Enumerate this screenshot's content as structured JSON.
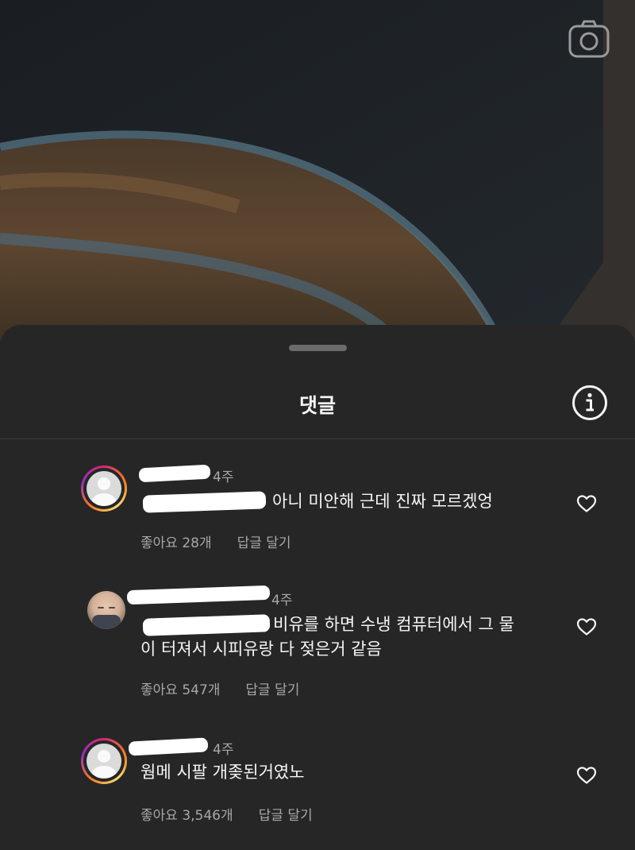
{
  "sheet": {
    "title": "댓글"
  },
  "comments": [
    {
      "time": "4주",
      "text_suffix": "아니 미안해 근데 진짜 모르겠엉",
      "text_line2": "",
      "likes": "좋아요 28개",
      "reply": "답글 달기",
      "avatar": "default-avatar-icon"
    },
    {
      "time": "4주",
      "text_suffix": "비유를 하면 수냉 컴퓨터에서 그 물",
      "text_line2": "이 터져서 시피유랑 다 젖은거 같음",
      "likes": "좋아요 547개",
      "reply": "답글 달기",
      "avatar": "user-photo"
    },
    {
      "time": "4주",
      "text_suffix": "웜메 시팔 개좆된거였노",
      "text_line2": "",
      "likes": "좋아요 3,546개",
      "reply": "답글 달기",
      "avatar": "default-avatar-icon"
    }
  ],
  "icons": {
    "camera": "camera-icon",
    "info": "info-icon",
    "like": "heart-icon"
  },
  "colors": {
    "sheet_bg": "#262626",
    "text": "#f5f5f5",
    "secondary": "#a8a8a8"
  }
}
